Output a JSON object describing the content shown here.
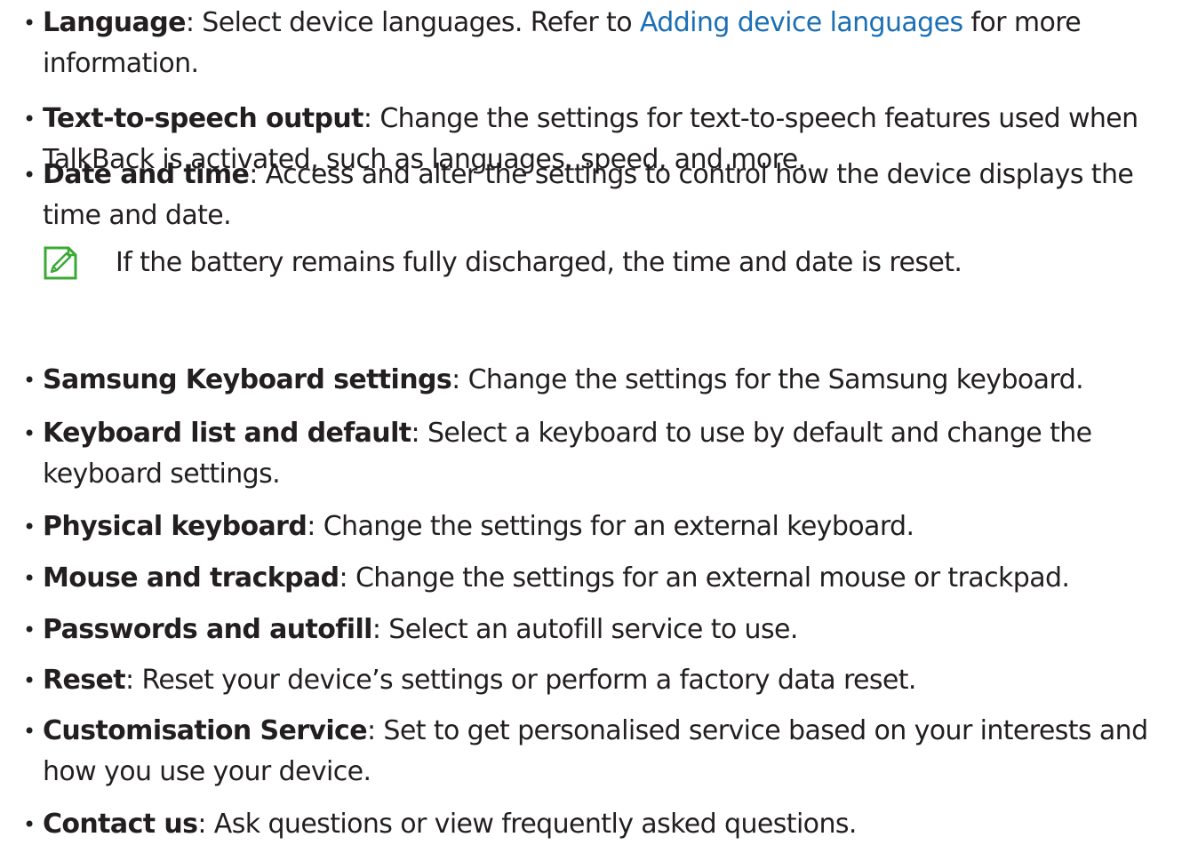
{
  "bullet_char": "•",
  "items": [
    {
      "term": "Language",
      "desc_before": ": Select device languages. Refer to ",
      "link": "Adding device languages",
      "desc_after": " for more information."
    },
    {
      "term": "Text-to-speech output",
      "desc": ": Change the settings for text-to-speech features used when TalkBack is activated, such as languages, speed, and more."
    },
    {
      "term": "Date and time",
      "desc": ": Access and alter the settings to control how the device displays the time and date."
    },
    {
      "term": "Samsung Keyboard settings",
      "desc": ": Change the settings for the Samsung keyboard."
    },
    {
      "term": "Keyboard list and default",
      "desc": ": Select a keyboard to use by default and change the keyboard settings."
    },
    {
      "term": "Physical keyboard",
      "desc": ": Change the settings for an external keyboard."
    },
    {
      "term": "Mouse and trackpad",
      "desc": ": Change the settings for an external mouse or trackpad."
    },
    {
      "term": "Passwords and autofill",
      "desc": ": Select an autofill service to use."
    },
    {
      "term": "Reset",
      "desc": ": Reset your device’s settings or perform a factory data reset."
    },
    {
      "term": "Customisation Service",
      "desc": ": Set to get personalised service based on your interests and how you use your device."
    },
    {
      "term": "Contact us",
      "desc": ": Ask questions or view frequently asked questions."
    }
  ],
  "note": {
    "icon": "note-pencil-icon",
    "text": "If the battery remains fully discharged, the time and date is reset.",
    "icon_color": "#3aa935"
  },
  "colors": {
    "text": "#231f20",
    "link": "#1a6fb5"
  }
}
